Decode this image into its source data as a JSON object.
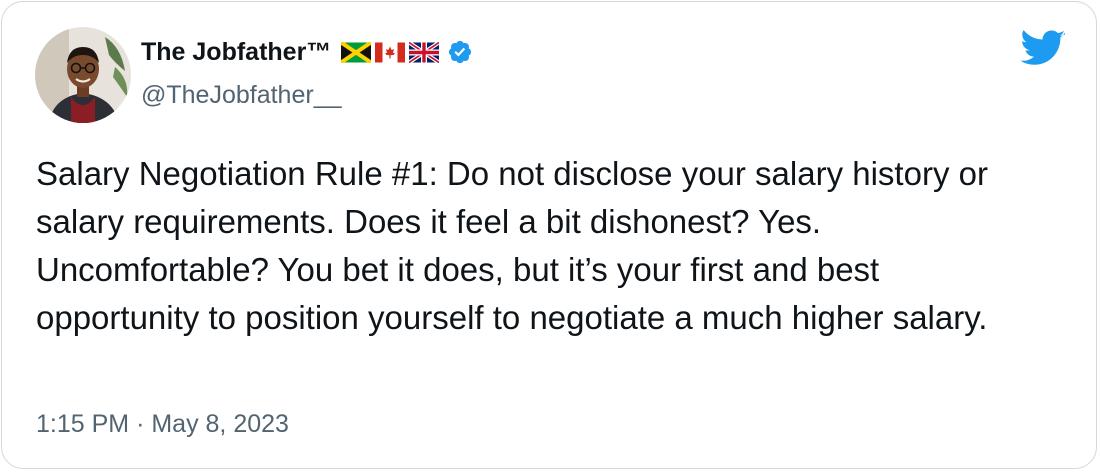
{
  "tweet": {
    "display_name": "The Jobfather™",
    "flag_icons": [
      "jamaica-flag-icon",
      "canada-flag-icon",
      "uk-flag-icon"
    ],
    "verified_icon": "verified-badge-icon",
    "handle": "@TheJobfather__",
    "text": "Salary Negotiation Rule #1: Do not disclose your salary history or salary requirements. Does it feel a bit dishonest? Yes. Uncomfortable? You bet it does, but it’s your first and best opportunity to position yourself to negotiate a much higher salary.",
    "time": "1:15 PM",
    "separator": "·",
    "date": "May 8, 2023",
    "logo_icon": "twitter-bird-icon"
  },
  "colors": {
    "text_primary": "#0f1419",
    "text_secondary": "#536471",
    "twitter_blue": "#1d9bf0",
    "border": "#cfd9de"
  }
}
